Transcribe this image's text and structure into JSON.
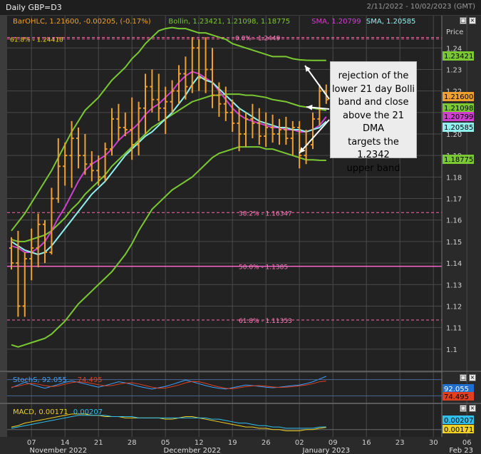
{
  "window": {
    "title": "Daily GBP=D3",
    "date_range": "2/11/2022 - 10/02/2023 (GMT)"
  },
  "colors": {
    "background": "#3c3c3c",
    "plot": "#222222",
    "grid": "#4a4a4a",
    "price_bar": "#f0a030",
    "bollinger": "#7ac832",
    "sma_short": "#d040d0",
    "sma_long": "#90f0f0",
    "fib_line": "#ff66aa",
    "fib_50": "#ff66cc",
    "stoch_k": "#40a0ff",
    "stoch_d": "#e04020",
    "macd": "#f0d020",
    "macd_signal": "#30c0f0"
  },
  "main_legend": [
    {
      "text": "BarOHLC, 1.21600, -0.00205, (-0.17%)",
      "color": "#f0a030"
    },
    {
      "text": "Bollin, 1.23421, 1.21098, 1.18775",
      "color": "#7ac832"
    },
    {
      "text": "SMA, 1.20799",
      "color": "#d040d0"
    },
    {
      "text": "SMA, 1.20585",
      "color": "#90f0f0"
    }
  ],
  "price_axis_label": "Price",
  "price_badges": [
    {
      "text": "1.23421",
      "bg": "#7ac832",
      "fg": "#000000",
      "value": 1.23421
    },
    {
      "text": "1.21600",
      "bg": "#f0a030",
      "fg": "#000000",
      "value": 1.216
    },
    {
      "text": "1.21098",
      "bg": "#7ac832",
      "fg": "#000000",
      "value": 1.21098
    },
    {
      "text": "1.20799",
      "bg": "#d040d0",
      "fg": "#000000",
      "value": 1.20799
    },
    {
      "text": "1.20585",
      "bg": "#90f0f0",
      "fg": "#000000",
      "value": 1.20585
    },
    {
      "text": "1.18775",
      "bg": "#7ac832",
      "fg": "#000000",
      "value": 1.18775
    }
  ],
  "fib_levels": [
    {
      "label": "61.8% - 1.24418",
      "value": 1.24418
    },
    {
      "label": "0.0% - 1.2449",
      "value": 1.2449
    },
    {
      "label": "38.2% - 1.16347",
      "value": 1.16347
    },
    {
      "label": "50.0% - 1.1385",
      "value": 1.1385
    },
    {
      "label": "61.8% - 1.11353",
      "value": 1.11353
    }
  ],
  "callout": {
    "lines": [
      "rejection of the",
      "lower 21 day Bolli",
      "band and close",
      "above the 21 DMA",
      "targets the 1.2342",
      "upper band"
    ]
  },
  "stoch": {
    "legend": [
      {
        "text": "StochS, 92.055",
        "color": "#40a0ff"
      },
      {
        "text": "74.495",
        "color": "#e04020"
      }
    ],
    "badges": [
      {
        "text": "92.055",
        "bg": "#1f6fd0",
        "fg": "#ffffff"
      },
      {
        "text": "74.495",
        "bg": "#e04020",
        "fg": "#000000"
      }
    ]
  },
  "macd": {
    "legend": [
      {
        "text": "MACD, 0.00171",
        "color": "#f0d020"
      },
      {
        "text": "0.00207",
        "color": "#30c0f0"
      }
    ],
    "badges": [
      {
        "text": "0.00207",
        "bg": "#30c0f0",
        "fg": "#000000"
      },
      {
        "text": "0.00171",
        "bg": "#f0d020",
        "fg": "#000000"
      }
    ]
  },
  "chart_data": {
    "type": "ohlc_bar",
    "title": "Daily GBP=D3",
    "ylabel": "Price",
    "ylim": [
      1.09,
      1.255
    ],
    "yticks": [
      1.1,
      1.11,
      1.12,
      1.13,
      1.14,
      1.15,
      1.16,
      1.17,
      1.18,
      1.19,
      1.2,
      1.21,
      1.22,
      1.23,
      1.24
    ],
    "day_ticks": [
      "07",
      "14",
      "21",
      "28",
      "05",
      "12",
      "19",
      "26",
      "02",
      "09",
      "16",
      "23",
      "30",
      "06"
    ],
    "month_labels": [
      "November 2022",
      "December 2022",
      "January 2023",
      "Feb 23"
    ],
    "day_tick_index": [
      3,
      8,
      13,
      18,
      23,
      28,
      33,
      38,
      43,
      48,
      53,
      58,
      63,
      68
    ],
    "month_label_index": [
      7,
      27,
      47,
      68
    ],
    "bars": [
      {
        "o": 1.147,
        "h": 1.152,
        "l": 1.137,
        "c": 1.14
      },
      {
        "o": 1.14,
        "h": 1.155,
        "l": 1.115,
        "c": 1.12
      },
      {
        "o": 1.12,
        "h": 1.145,
        "l": 1.115,
        "c": 1.142
      },
      {
        "o": 1.142,
        "h": 1.156,
        "l": 1.132,
        "c": 1.147
      },
      {
        "o": 1.147,
        "h": 1.163,
        "l": 1.138,
        "c": 1.158
      },
      {
        "o": 1.158,
        "h": 1.16,
        "l": 1.14,
        "c": 1.145
      },
      {
        "o": 1.145,
        "h": 1.175,
        "l": 1.144,
        "c": 1.17
      },
      {
        "o": 1.17,
        "h": 1.198,
        "l": 1.168,
        "c": 1.185
      },
      {
        "o": 1.185,
        "h": 1.196,
        "l": 1.176,
        "c": 1.19
      },
      {
        "o": 1.19,
        "h": 1.206,
        "l": 1.175,
        "c": 1.198
      },
      {
        "o": 1.198,
        "h": 1.203,
        "l": 1.184,
        "c": 1.19
      },
      {
        "o": 1.19,
        "h": 1.2,
        "l": 1.181,
        "c": 1.186
      },
      {
        "o": 1.186,
        "h": 1.192,
        "l": 1.178,
        "c": 1.183
      },
      {
        "o": 1.183,
        "h": 1.19,
        "l": 1.176,
        "c": 1.18
      },
      {
        "o": 1.18,
        "h": 1.196,
        "l": 1.178,
        "c": 1.193
      },
      {
        "o": 1.193,
        "h": 1.212,
        "l": 1.19,
        "c": 1.207
      },
      {
        "o": 1.207,
        "h": 1.214,
        "l": 1.197,
        "c": 1.203
      },
      {
        "o": 1.203,
        "h": 1.21,
        "l": 1.199,
        "c": 1.202
      },
      {
        "o": 1.202,
        "h": 1.217,
        "l": 1.188,
        "c": 1.195
      },
      {
        "o": 1.195,
        "h": 1.215,
        "l": 1.19,
        "c": 1.212
      },
      {
        "o": 1.212,
        "h": 1.228,
        "l": 1.2,
        "c": 1.222
      },
      {
        "o": 1.222,
        "h": 1.23,
        "l": 1.21,
        "c": 1.216
      },
      {
        "o": 1.216,
        "h": 1.228,
        "l": 1.206,
        "c": 1.212
      },
      {
        "o": 1.212,
        "h": 1.222,
        "l": 1.2,
        "c": 1.215
      },
      {
        "o": 1.215,
        "h": 1.225,
        "l": 1.21,
        "c": 1.22
      },
      {
        "o": 1.22,
        "h": 1.232,
        "l": 1.214,
        "c": 1.228
      },
      {
        "o": 1.228,
        "h": 1.236,
        "l": 1.216,
        "c": 1.222
      },
      {
        "o": 1.222,
        "h": 1.245,
        "l": 1.219,
        "c": 1.24
      },
      {
        "o": 1.24,
        "h": 1.244,
        "l": 1.22,
        "c": 1.226
      },
      {
        "o": 1.226,
        "h": 1.245,
        "l": 1.219,
        "c": 1.23
      },
      {
        "o": 1.23,
        "h": 1.24,
        "l": 1.212,
        "c": 1.218
      },
      {
        "o": 1.218,
        "h": 1.224,
        "l": 1.208,
        "c": 1.214
      },
      {
        "o": 1.214,
        "h": 1.222,
        "l": 1.206,
        "c": 1.21
      },
      {
        "o": 1.21,
        "h": 1.216,
        "l": 1.201,
        "c": 1.205
      },
      {
        "o": 1.205,
        "h": 1.212,
        "l": 1.192,
        "c": 1.2
      },
      {
        "o": 1.2,
        "h": 1.21,
        "l": 1.194,
        "c": 1.207
      },
      {
        "o": 1.207,
        "h": 1.214,
        "l": 1.198,
        "c": 1.205
      },
      {
        "o": 1.205,
        "h": 1.212,
        "l": 1.195,
        "c": 1.199
      },
      {
        "o": 1.199,
        "h": 1.21,
        "l": 1.194,
        "c": 1.203
      },
      {
        "o": 1.203,
        "h": 1.209,
        "l": 1.196,
        "c": 1.2
      },
      {
        "o": 1.2,
        "h": 1.207,
        "l": 1.195,
        "c": 1.202
      },
      {
        "o": 1.202,
        "h": 1.208,
        "l": 1.195,
        "c": 1.198
      },
      {
        "o": 1.198,
        "h": 1.206,
        "l": 1.19,
        "c": 1.203
      },
      {
        "o": 1.203,
        "h": 1.206,
        "l": 1.184,
        "c": 1.19
      },
      {
        "o": 1.19,
        "h": 1.202,
        "l": 1.186,
        "c": 1.195
      },
      {
        "o": 1.195,
        "h": 1.21,
        "l": 1.193,
        "c": 1.207
      },
      {
        "o": 1.207,
        "h": 1.223,
        "l": 1.204,
        "c": 1.22
      },
      {
        "o": 1.22,
        "h": 1.223,
        "l": 1.214,
        "c": 1.216
      }
    ],
    "series": [
      {
        "name": "Bollin upper",
        "values": [
          1.155,
          1.159,
          1.163,
          1.168,
          1.173,
          1.178,
          1.183,
          1.189,
          1.195,
          1.201,
          1.206,
          1.211,
          1.214,
          1.217,
          1.221,
          1.225,
          1.228,
          1.231,
          1.235,
          1.238,
          1.242,
          1.245,
          1.248,
          1.249,
          1.2495,
          1.249,
          1.249,
          1.248,
          1.247,
          1.247,
          1.246,
          1.245,
          1.244,
          1.242,
          1.241,
          1.24,
          1.239,
          1.238,
          1.237,
          1.236,
          1.236,
          1.236,
          1.235,
          1.2345,
          1.2343,
          1.2342,
          1.23421,
          1.2342
        ]
      },
      {
        "name": "Bollin mid",
        "values": [
          1.151,
          1.15,
          1.15,
          1.151,
          1.152,
          1.153,
          1.155,
          1.158,
          1.161,
          1.165,
          1.168,
          1.172,
          1.175,
          1.178,
          1.181,
          1.185,
          1.188,
          1.191,
          1.194,
          1.197,
          1.2,
          1.203,
          1.205,
          1.207,
          1.209,
          1.211,
          1.213,
          1.215,
          1.216,
          1.217,
          1.218,
          1.218,
          1.2185,
          1.2185,
          1.2185,
          1.218,
          1.218,
          1.2175,
          1.217,
          1.216,
          1.2155,
          1.215,
          1.214,
          1.213,
          1.2125,
          1.212,
          1.2115,
          1.21098
        ]
      },
      {
        "name": "Bollin lower",
        "values": [
          1.102,
          1.101,
          1.102,
          1.103,
          1.104,
          1.105,
          1.107,
          1.11,
          1.113,
          1.117,
          1.121,
          1.124,
          1.127,
          1.13,
          1.133,
          1.136,
          1.14,
          1.144,
          1.149,
          1.155,
          1.16,
          1.165,
          1.168,
          1.171,
          1.174,
          1.176,
          1.178,
          1.18,
          1.183,
          1.186,
          1.189,
          1.191,
          1.192,
          1.193,
          1.194,
          1.194,
          1.194,
          1.194,
          1.193,
          1.193,
          1.192,
          1.191,
          1.19,
          1.189,
          1.188,
          1.188,
          1.1878,
          1.18775
        ]
      },
      {
        "name": "SMA 1.20799",
        "values": [
          1.148,
          1.147,
          1.145,
          1.145,
          1.147,
          1.15,
          1.155,
          1.161,
          1.166,
          1.172,
          1.178,
          1.183,
          1.186,
          1.188,
          1.19,
          1.193,
          1.197,
          1.2,
          1.202,
          1.205,
          1.209,
          1.212,
          1.214,
          1.217,
          1.22,
          1.224,
          1.227,
          1.229,
          1.228,
          1.226,
          1.224,
          1.22,
          1.216,
          1.212,
          1.209,
          1.207,
          1.206,
          1.205,
          1.204,
          1.203,
          1.203,
          1.202,
          1.202,
          1.201,
          1.201,
          1.202,
          1.204,
          1.20799
        ]
      },
      {
        "name": "SMA 1.20585",
        "values": [
          1.15,
          1.148,
          1.146,
          1.145,
          1.144,
          1.145,
          1.148,
          1.152,
          1.156,
          1.16,
          1.164,
          1.168,
          1.172,
          1.175,
          1.178,
          1.182,
          1.186,
          1.19,
          1.193,
          1.196,
          1.199,
          1.201,
          1.204,
          1.207,
          1.21,
          1.214,
          1.218,
          1.223,
          1.227,
          1.225,
          1.224,
          1.221,
          1.218,
          1.215,
          1.212,
          1.21,
          1.208,
          1.206,
          1.205,
          1.204,
          1.203,
          1.203,
          1.202,
          1.202,
          1.201,
          1.202,
          1.203,
          1.20585
        ]
      }
    ],
    "stoch_series": [
      {
        "name": "StochS",
        "values": [
          50,
          60,
          70,
          62,
          55,
          48,
          55,
          62,
          70,
          75,
          70,
          64,
          58,
          52,
          58,
          65,
          72,
          68,
          62,
          55,
          50,
          45,
          50,
          55,
          62,
          70,
          78,
          72,
          65,
          58,
          52,
          48,
          45,
          50,
          55,
          60,
          58,
          55,
          52,
          50,
          52,
          55,
          58,
          60,
          65,
          72,
          82,
          92.055
        ]
      },
      {
        "name": "signal",
        "values": [
          52,
          56,
          62,
          66,
          63,
          58,
          54,
          57,
          63,
          69,
          72,
          70,
          66,
          61,
          57,
          58,
          63,
          67,
          68,
          64,
          58,
          52,
          48,
          49,
          54,
          60,
          68,
          73,
          72,
          66,
          59,
          53,
          48,
          46,
          50,
          54,
          57,
          58,
          56,
          53,
          51,
          52,
          54,
          57,
          60,
          65,
          72,
          74.495
        ]
      }
    ],
    "stoch_ylim": [
      0,
      100
    ],
    "macd_series": [
      {
        "name": "MACD",
        "values": [
          0.002,
          0.003,
          0.005,
          0.006,
          0.007,
          0.008,
          0.009,
          0.01,
          0.011,
          0.012,
          0.012,
          0.012,
          0.011,
          0.011,
          0.01,
          0.01,
          0.01,
          0.009,
          0.009,
          0.009,
          0.009,
          0.009,
          0.009,
          0.008,
          0.008,
          0.009,
          0.01,
          0.01,
          0.009,
          0.008,
          0.007,
          0.006,
          0.005,
          0.004,
          0.003,
          0.002,
          0.002,
          0.001,
          0.001,
          0.0,
          0.0,
          -0.001,
          -0.001,
          -0.001,
          0.0,
          0.0,
          0.001,
          0.00171
        ]
      },
      {
        "name": "signal",
        "values": [
          0.001,
          0.002,
          0.003,
          0.004,
          0.005,
          0.006,
          0.007,
          0.008,
          0.009,
          0.01,
          0.011,
          0.011,
          0.011,
          0.011,
          0.011,
          0.01,
          0.01,
          0.01,
          0.01,
          0.009,
          0.009,
          0.009,
          0.009,
          0.009,
          0.009,
          0.009,
          0.009,
          0.009,
          0.009,
          0.009,
          0.008,
          0.008,
          0.007,
          0.006,
          0.005,
          0.005,
          0.004,
          0.003,
          0.003,
          0.002,
          0.002,
          0.001,
          0.001,
          0.001,
          0.001,
          0.001,
          0.002,
          0.00207
        ]
      }
    ],
    "macd_ylim": [
      -0.004,
      0.018
    ]
  }
}
